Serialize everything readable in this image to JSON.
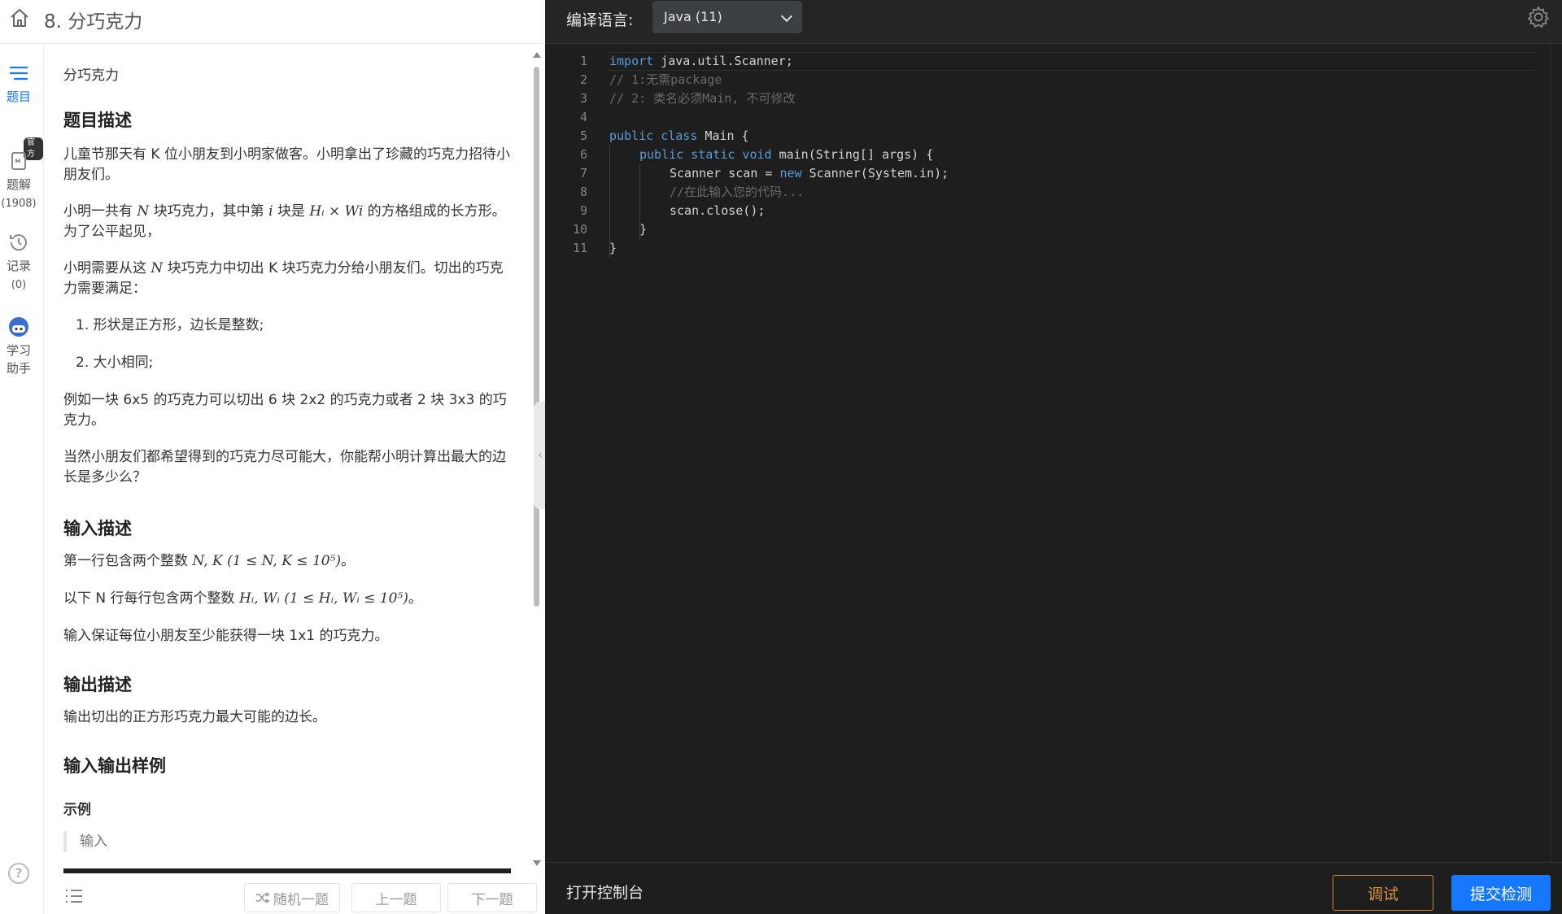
{
  "header": {
    "title": "8. 分巧克力"
  },
  "rail": {
    "problem": "题目",
    "solution": "题解",
    "solution_count": "(1908)",
    "official_badge": "官方",
    "records": "记录",
    "records_count": "(0)",
    "assistant_line1": "学习",
    "assistant_line2": "助手"
  },
  "problem": {
    "subtitle": "分巧克力",
    "desc_heading": "题目描述",
    "p1": "儿童节那天有 K 位小朋友到小明家做客。小明拿出了珍藏的巧克力招待小朋友们。",
    "p2_a": "小明一共有",
    "p2_N": "N",
    "p2_b": "块巧克力，其中第",
    "p2_i": "i",
    "p2_c": "块是",
    "p2_dim": "Hᵢ × Wi",
    "p2_d": "的方格组成的长方形。为了公平起见，",
    "p3_a": "小明需要从这",
    "p3_N": "N",
    "p3_b": "块巧克力中切出 K 块巧克力分给小朋友们。切出的巧克力需要满足：",
    "li1": "1. 形状是正方形，边长是整数;",
    "li2": "2. 大小相同;",
    "p4": "例如一块 6x5 的巧克力可以切出 6 块 2x2 的巧克力或者 2 块 3x3 的巧克力。",
    "p5": "当然小朋友们都希望得到的巧克力尽可能大，你能帮小明计算出最大的边长是多少么？",
    "input_heading": "输入描述",
    "in1_a": "第一行包含两个整数",
    "in1_math": "N, K (1 ≤ N, K ≤ 10⁵)",
    "in1_b": "。",
    "in2_a": "以下 N 行每行包含两个整数",
    "in2_math": "Hᵢ, Wᵢ (1 ≤ Hᵢ, Wᵢ ≤ 10⁵)",
    "in2_b": "。",
    "in3": "输入保证每位小朋友至少能获得一块 1x1 的巧克力。",
    "output_heading": "输出描述",
    "out1": "输出切出的正方形巧克力最大可能的边长。",
    "sample_heading": "输入输出样例",
    "sample_label": "示例",
    "sample_input": "输入"
  },
  "footer_left": {
    "random": "随机一题",
    "prev": "上一题",
    "next": "下一题"
  },
  "editor": {
    "lang_label": "编译语言:",
    "lang_value": "Java (11)",
    "lines": [
      {
        "n": "1",
        "indent": 0,
        "parts": [
          [
            "kw",
            "import"
          ],
          [
            "t",
            " java.util.Scanner;"
          ]
        ]
      },
      {
        "n": "2",
        "indent": 0,
        "parts": [
          [
            "cm",
            "// 1:无需package"
          ]
        ]
      },
      {
        "n": "3",
        "indent": 0,
        "parts": [
          [
            "cm",
            "// 2: 类名必须Main, 不可修改"
          ]
        ]
      },
      {
        "n": "4",
        "indent": 0,
        "parts": []
      },
      {
        "n": "5",
        "indent": 0,
        "parts": [
          [
            "kw",
            "public class"
          ],
          [
            "t",
            " Main {"
          ]
        ]
      },
      {
        "n": "6",
        "indent": 1,
        "parts": [
          [
            "kw",
            "public static void"
          ],
          [
            "t",
            " main(String[] args) {"
          ]
        ]
      },
      {
        "n": "7",
        "indent": 2,
        "parts": [
          [
            "t",
            "Scanner scan = "
          ],
          [
            "kw",
            "new"
          ],
          [
            "t",
            " Scanner(System.in);"
          ]
        ]
      },
      {
        "n": "8",
        "indent": 2,
        "parts": [
          [
            "cm",
            "//在此输入您的代码..."
          ]
        ]
      },
      {
        "n": "9",
        "indent": 2,
        "parts": [
          [
            "t",
            "scan.close();"
          ]
        ]
      },
      {
        "n": "10",
        "indent": 1,
        "parts": [
          [
            "t",
            "}"
          ]
        ]
      },
      {
        "n": "11",
        "indent": 0,
        "parts": [
          [
            "t",
            "}"
          ]
        ]
      }
    ],
    "console": "打开控制台",
    "debug": "调试",
    "submit": "提交检测"
  },
  "colors": {
    "accent": "#1677ff",
    "debug": "#d8973f",
    "keyword": "#569cd6",
    "comment": "#6a6a6a",
    "editor_bg": "#1e1e1e"
  }
}
